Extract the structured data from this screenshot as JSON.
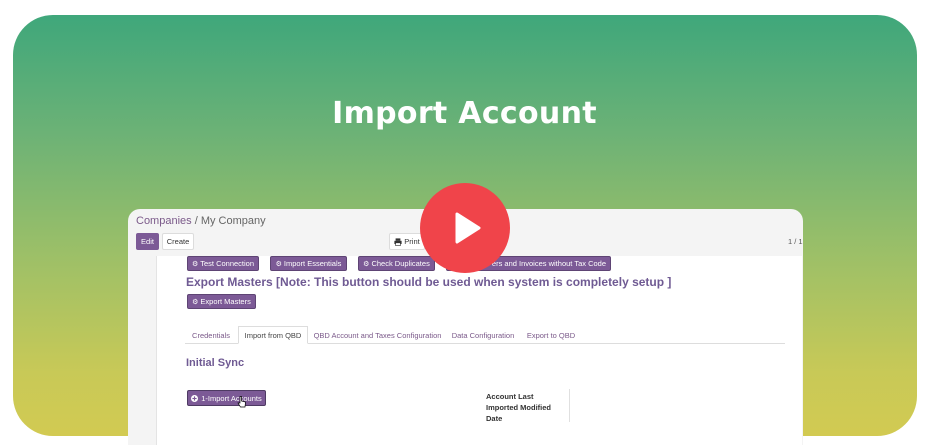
{
  "banner": {
    "title": "Import Account"
  },
  "breadcrumb": {
    "parent": "Companies",
    "separator": "/",
    "current": "My Company"
  },
  "toolbar": {
    "edit_label": "Edit",
    "create_label": "Create",
    "print_label": "Print",
    "pager": "1 / 1"
  },
  "actions": {
    "test_connection": "Test Connection",
    "import_essentials": "Import Essentials",
    "check_duplicates": "Check Duplicates",
    "export_partial": "ers and Invoices without Tax Code",
    "export_masters": "Export Masters"
  },
  "export_heading": "Export Masters [Note: This button should be used when system is completely setup ]",
  "tabs": [
    {
      "label": "Credentials"
    },
    {
      "label": "Import from QBD"
    },
    {
      "label": "QBD Account and Taxes Configuration"
    },
    {
      "label": "Data Configuration"
    },
    {
      "label": "Export to QBD"
    }
  ],
  "initial_sync": {
    "title": "Initial Sync",
    "import_button": "1-Import Accounts"
  },
  "field": {
    "label": "Account Last Imported Modified Date"
  },
  "colors": {
    "primary": "#7c5a96",
    "heading": "#6f5a93",
    "play": "#f0444a"
  },
  "icons": [
    "gear-icon",
    "print-icon",
    "plus-circle-icon",
    "play-icon",
    "pointer-cursor-icon"
  ]
}
